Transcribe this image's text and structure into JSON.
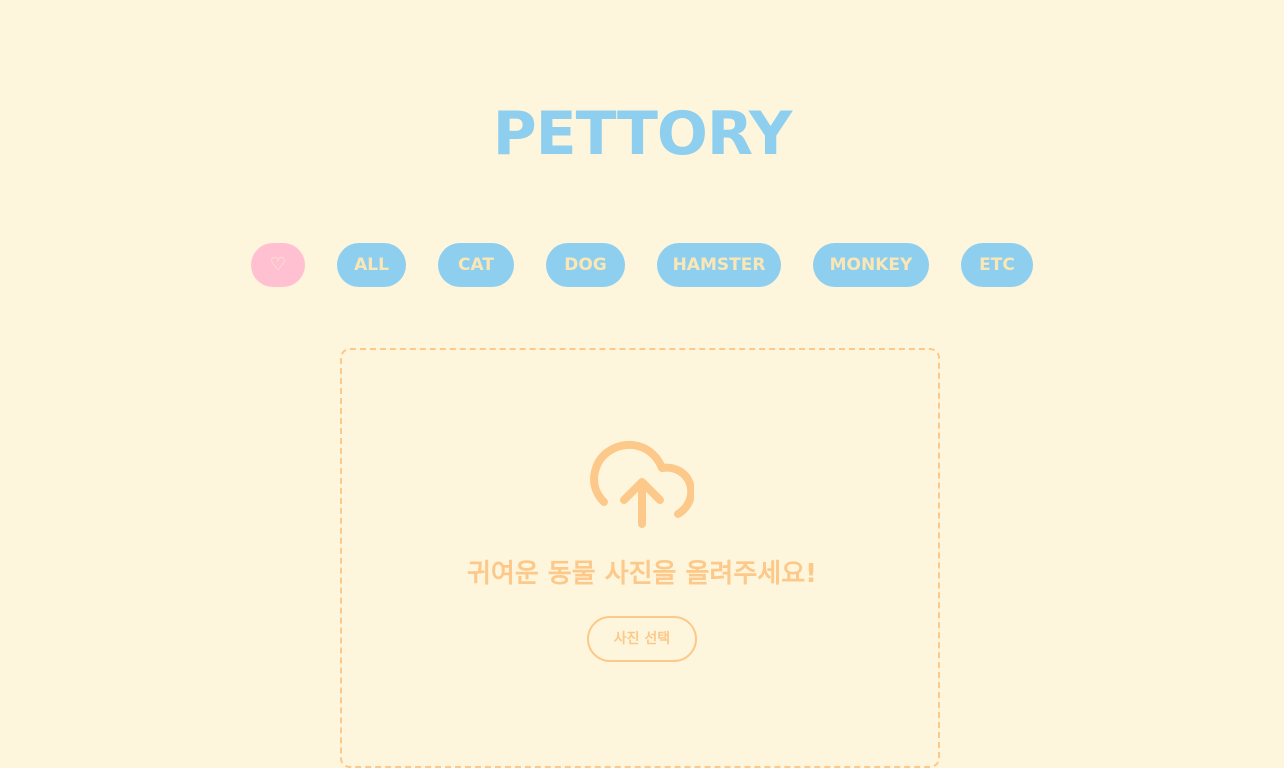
{
  "app": {
    "title": "PETTORY"
  },
  "filters": [
    {
      "label": "♡",
      "active": true
    },
    {
      "label": "ALL"
    },
    {
      "label": "CAT"
    },
    {
      "label": "DOG"
    },
    {
      "label": "HAMSTER"
    },
    {
      "label": "MONKEY"
    },
    {
      "label": "ETC"
    }
  ],
  "upload": {
    "icon": "cloud-upload-icon",
    "message": "귀여운 동물 사진을 올려주세요!",
    "button_label": "사진 선택"
  },
  "colors": {
    "background": "#fef6dc",
    "primary_blue": "#8ecfef",
    "favorite_pink": "#ffc1d2",
    "chip_text": "#fbe7b5",
    "accent_orange": "#fcc98a"
  }
}
